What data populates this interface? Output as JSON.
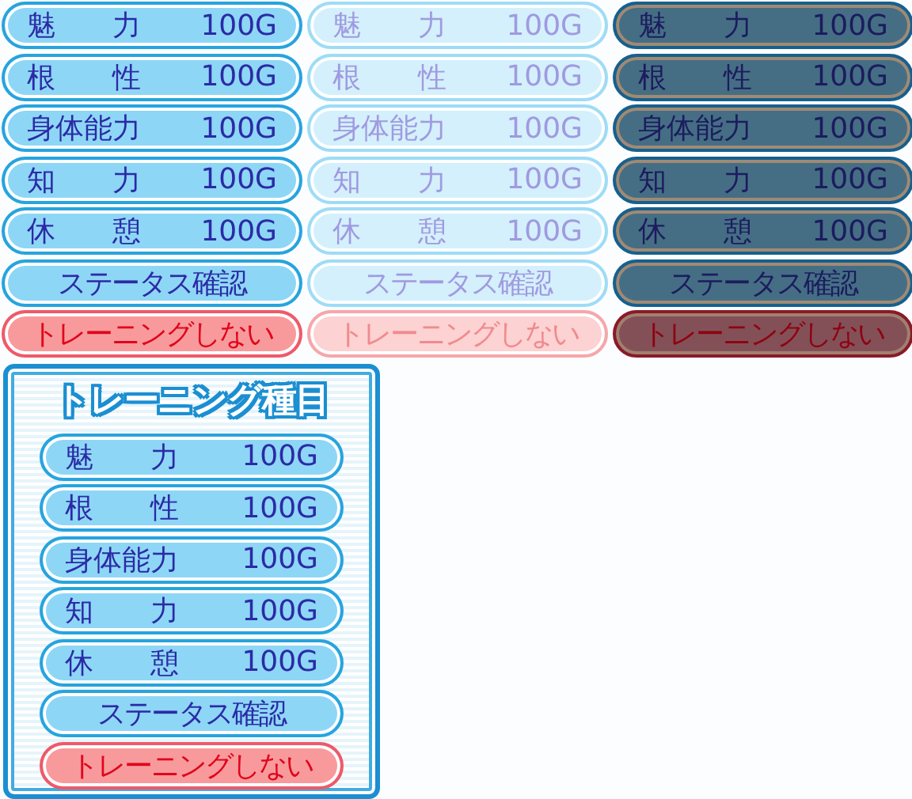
{
  "sheets": [
    {
      "disabled": false,
      "pressed": false,
      "buttons": [
        {
          "kind": "training",
          "label": "魅　　力",
          "price": "100G"
        },
        {
          "kind": "training",
          "label": "根　　性",
          "price": "100G"
        },
        {
          "kind": "training",
          "label": "身体能力",
          "price": "100G"
        },
        {
          "kind": "training",
          "label": "知　　力",
          "price": "100G"
        },
        {
          "kind": "training",
          "label": "休　　憩",
          "price": "100G"
        },
        {
          "kind": "status",
          "label": "ステータス確認"
        },
        {
          "kind": "cancel",
          "label": "トレーニングしない"
        }
      ]
    },
    {
      "disabled": true,
      "pressed": false,
      "buttons": [
        {
          "kind": "training",
          "label": "魅　　力",
          "price": "100G"
        },
        {
          "kind": "training",
          "label": "根　　性",
          "price": "100G"
        },
        {
          "kind": "training",
          "label": "身体能力",
          "price": "100G"
        },
        {
          "kind": "training",
          "label": "知　　力",
          "price": "100G"
        },
        {
          "kind": "training",
          "label": "休　　憩",
          "price": "100G"
        },
        {
          "kind": "status",
          "label": "ステータス確認"
        },
        {
          "kind": "cancel",
          "label": "トレーニングしない"
        }
      ]
    },
    {
      "disabled": false,
      "pressed": true,
      "buttons": [
        {
          "kind": "training",
          "label": "魅　　力",
          "price": "100G"
        },
        {
          "kind": "training",
          "label": "根　　性",
          "price": "100G"
        },
        {
          "kind": "training",
          "label": "身体能力",
          "price": "100G"
        },
        {
          "kind": "training",
          "label": "知　　力",
          "price": "100G"
        },
        {
          "kind": "training",
          "label": "休　　憩",
          "price": "100G"
        },
        {
          "kind": "status",
          "label": "ステータス確認"
        },
        {
          "kind": "cancel",
          "label": "トレーニングしない"
        }
      ]
    }
  ],
  "panel": {
    "title": "トレーニング種目",
    "disabled": false,
    "pressed": false,
    "buttons": [
      {
        "kind": "training",
        "label": "魅　　力",
        "price": "100G"
      },
      {
        "kind": "training",
        "label": "根　　性",
        "price": "100G"
      },
      {
        "kind": "training",
        "label": "身体能力",
        "price": "100G"
      },
      {
        "kind": "training",
        "label": "知　　力",
        "price": "100G"
      },
      {
        "kind": "training",
        "label": "休　　憩",
        "price": "100G"
      },
      {
        "kind": "status",
        "label": "ステータス確認"
      },
      {
        "kind": "cancel",
        "label": "トレーニングしない"
      }
    ]
  }
}
